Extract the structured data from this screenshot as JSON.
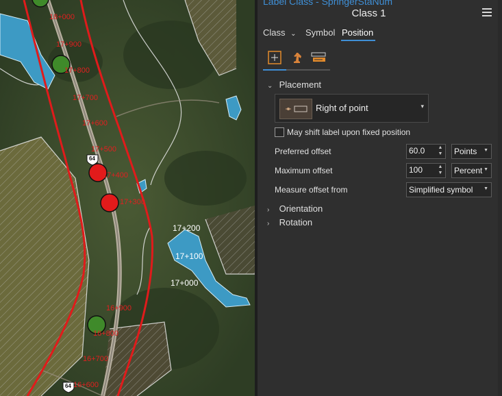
{
  "map": {
    "labels": [
      {
        "text": "18+000",
        "color": "#e02020"
      },
      {
        "text": "17+900",
        "color": "#e02020"
      },
      {
        "text": "17+800",
        "color": "#e02020"
      },
      {
        "text": "17+700",
        "color": "#e02020"
      },
      {
        "text": "17+600",
        "color": "#e02020"
      },
      {
        "text": "17+500",
        "color": "#e02020"
      },
      {
        "text": "17+400",
        "color": "#e02020"
      },
      {
        "text": "17+300",
        "color": "#e02020"
      },
      {
        "text": "16+900",
        "color": "#e02020"
      },
      {
        "text": "16+800",
        "color": "#e02020"
      },
      {
        "text": "16+700",
        "color": "#e02020"
      },
      {
        "text": "16+600",
        "color": "#e02020"
      },
      {
        "text": "17+200",
        "color": "#ffffff"
      },
      {
        "text": "17+100",
        "color": "#ffffff"
      },
      {
        "text": "17+000",
        "color": "#ffffff"
      }
    ],
    "shields": [
      "64",
      "64"
    ]
  },
  "panel": {
    "header_top": "Label Class - SpringerStaNum",
    "title": "Class 1",
    "menu_icon": "hamburger-menu-icon",
    "tabs": [
      {
        "label": "Class",
        "dropdown": true
      },
      {
        "label": "Symbol"
      },
      {
        "label": "Position",
        "active": true
      }
    ],
    "subtabs": [
      "placement-icon",
      "chess-knight-icon",
      "label-stack-icon"
    ],
    "placement": {
      "section": "Placement",
      "value": "Right of point",
      "checkbox_label": "May shift label upon fixed position",
      "checked": false,
      "preferred_offset": {
        "label": "Preferred offset",
        "value": "60.0",
        "unit": "Points"
      },
      "maximum_offset": {
        "label": "Maximum offset",
        "value": "100",
        "unit": "Percent"
      },
      "measure_from": {
        "label": "Measure offset from",
        "value": "Simplified symbol"
      }
    },
    "orientation": "Orientation",
    "rotation": "Rotation",
    "accent": "#3f8fd6"
  }
}
